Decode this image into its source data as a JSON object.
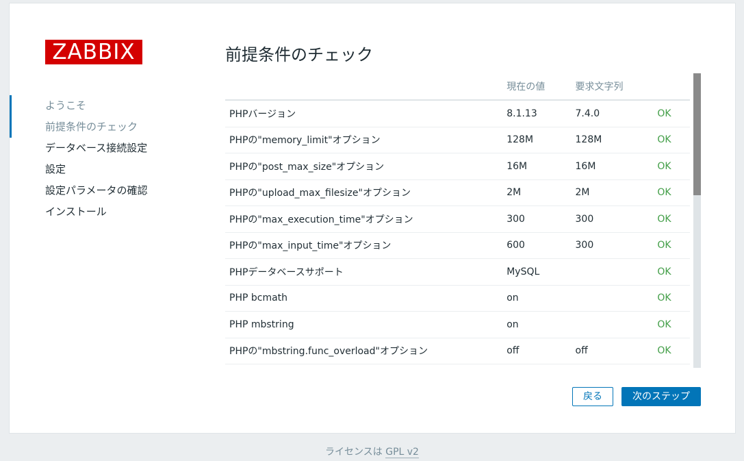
{
  "logo": "ZABBIX",
  "nav": {
    "items": [
      {
        "label": "ようこそ"
      },
      {
        "label": "前提条件のチェック"
      },
      {
        "label": "データベース接続設定"
      },
      {
        "label": "設定"
      },
      {
        "label": "設定パラメータの確認"
      },
      {
        "label": "インストール"
      }
    ],
    "current_index": 1
  },
  "title": "前提条件のチェック",
  "table": {
    "headers": [
      "",
      "現在の値",
      "要求文字列",
      ""
    ],
    "rows": [
      {
        "name": "PHPバージョン",
        "current": "8.1.13",
        "required": "7.4.0",
        "status": "OK"
      },
      {
        "name": "PHPの\"memory_limit\"オプション",
        "current": "128M",
        "required": "128M",
        "status": "OK"
      },
      {
        "name": "PHPの\"post_max_size\"オプション",
        "current": "16M",
        "required": "16M",
        "status": "OK"
      },
      {
        "name": "PHPの\"upload_max_filesize\"オプション",
        "current": "2M",
        "required": "2M",
        "status": "OK"
      },
      {
        "name": "PHPの\"max_execution_time\"オプション",
        "current": "300",
        "required": "300",
        "status": "OK"
      },
      {
        "name": "PHPの\"max_input_time\"オプション",
        "current": "600",
        "required": "300",
        "status": "OK"
      },
      {
        "name": "PHPデータベースサポート",
        "current": "MySQL",
        "required": "",
        "status": "OK"
      },
      {
        "name": "PHP bcmath",
        "current": "on",
        "required": "",
        "status": "OK"
      },
      {
        "name": "PHP mbstring",
        "current": "on",
        "required": "",
        "status": "OK"
      },
      {
        "name": "PHPの\"mbstring.func_overload\"オプション",
        "current": "off",
        "required": "off",
        "status": "OK"
      }
    ]
  },
  "buttons": {
    "back": "戻る",
    "next": "次のステップ"
  },
  "footer": {
    "prefix": "ライセンスは ",
    "link": "GPL v2"
  },
  "colors": {
    "brand": "#d40000",
    "accent": "#0275b8",
    "ok": "#429e47"
  }
}
